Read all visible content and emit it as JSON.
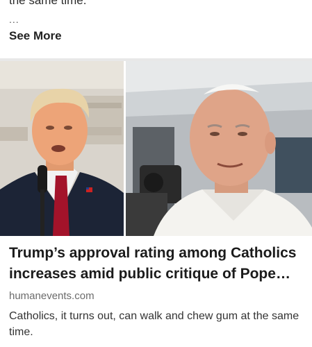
{
  "previous_post": {
    "snippet_tail": "the same time.",
    "ellipsis": "...",
    "see_more_label": "See More"
  },
  "article": {
    "image_left_subject": "trump-portrait-photo",
    "image_right_subject": "pope-leo-photo",
    "headline": "Trump’s approval rating among Catholics increases amid public critique of Pope Le...",
    "source": "humanevents.com",
    "description": "Catholics, it turns out, can walk and chew gum at the same time."
  },
  "colors": {
    "background": "#ffffff",
    "divider": "#e8e8e8",
    "source_text": "#6b6b6b"
  }
}
